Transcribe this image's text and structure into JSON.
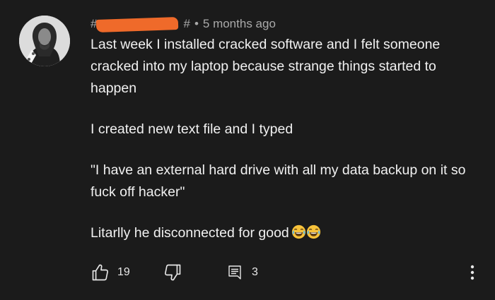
{
  "comment": {
    "author_handle": "#",
    "author_handle_tail": "#",
    "timestamp": "5 months ago",
    "separator": "•",
    "lines": [
      "Last week I installed cracked software and I felt someone cracked into my laptop because strange things started to happen",
      "I created new text file and I typed",
      "\"I have an external hard drive with all my data backup on it so fuck off hacker\"",
      "Litarlly he disconnected for good"
    ],
    "emoji": [
      "face-with-tears-of-joy",
      "face-with-tears-of-joy"
    ]
  },
  "actions": {
    "like_count": "19",
    "reply_count": "3",
    "icons": [
      "thumbs-up-icon",
      "thumbs-down-icon",
      "comment-icon",
      "more-vertical-icon"
    ]
  },
  "colors": {
    "background": "#1b1b1b",
    "text": "#f1f1f1",
    "meta": "#aaaaaa",
    "redaction": "#ef6a2a",
    "emoji": "#f7c23a"
  }
}
